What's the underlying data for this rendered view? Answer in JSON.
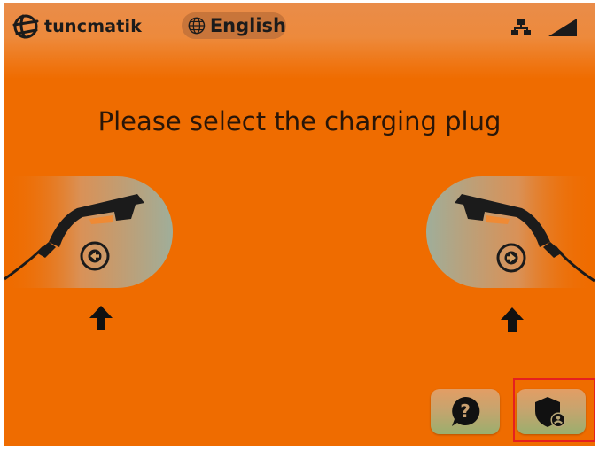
{
  "header": {
    "logo_text": "tuncmatik",
    "language_label": "English",
    "icons": [
      "globe-icon",
      "network-icon",
      "signal-icon"
    ]
  },
  "main": {
    "prompt": "Please select the charging plug",
    "plugs": [
      {
        "name": "left-plug",
        "direction_icon": "arrow-left-icon"
      },
      {
        "name": "right-plug",
        "direction_icon": "arrow-right-icon"
      }
    ]
  },
  "footer": {
    "buttons": [
      {
        "name": "help-button",
        "icon": "question-bubble-icon"
      },
      {
        "name": "admin-button",
        "icon": "shield-user-icon"
      }
    ]
  },
  "colors": {
    "background": "#ef6c00",
    "text": "#2a1608",
    "highlight": "#e5201f"
  }
}
